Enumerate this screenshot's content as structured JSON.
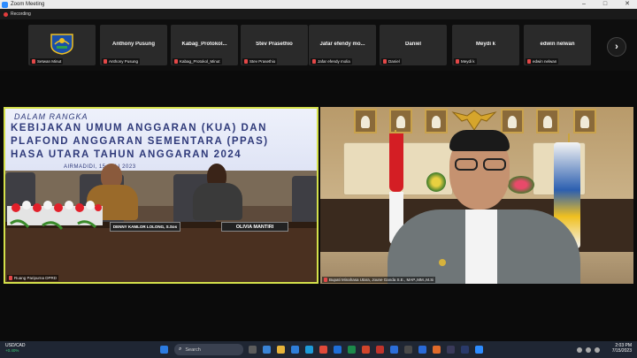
{
  "window": {
    "title": "Zoom Meeting",
    "minimize": "–",
    "maximize": "□",
    "close": "✕"
  },
  "recording": {
    "label": "Recording"
  },
  "gallery": {
    "tiles": [
      {
        "name": "",
        "footer": "Setwan Minut"
      },
      {
        "name": "Anthony Pusung",
        "footer": "Anthony Pusung"
      },
      {
        "name": "Kabag_Protokol...",
        "footer": "Kabag_Protokol_Minut"
      },
      {
        "name": "Stev Prasethio",
        "footer": "Stev Prasethio"
      },
      {
        "name": "Jafar efendy mo...",
        "footer": "Jafar efendy molia"
      },
      {
        "name": "Daniel",
        "footer": "Daniel"
      },
      {
        "name": "Meydi k",
        "footer": "Meydi k"
      },
      {
        "name": "edwin nelwan",
        "footer": "edwin nelwan"
      }
    ],
    "next_arrow": "›"
  },
  "video_left": {
    "banner_line1": "DALAM RANGKA",
    "banner_line2": "KEBIJAKAN UMUM ANGGARAN (KUA) DAN",
    "banner_line3": "PLAFOND ANGGARAN SEMENTARA (PPAS)",
    "banner_line4": "HASA UTARA TAHUN ANGGARAN 2024",
    "banner_line5": "AIRMADIDI, 15 JULI 2023",
    "nameplate_1": "DENNY KAMLOR LOLONG, S.Sos",
    "nameplate_2": "OLIVIA MANTIRI",
    "footer": "Ruang Paripurna DPRD"
  },
  "video_right": {
    "footer": "Bupati Minahasa Utara, Joune Ganda S.E., MAP.,MM.,M.Si"
  },
  "taskbar": {
    "weather_pair": "USD/CAD",
    "weather_change": "+0.40%",
    "search_placeholder": "Search",
    "time": "2:03 PM",
    "date": "7/15/2023"
  },
  "colors": {
    "accent_border": "#d4e04a",
    "mic_muted": "#e34848",
    "taskbar": "#1f2633"
  }
}
